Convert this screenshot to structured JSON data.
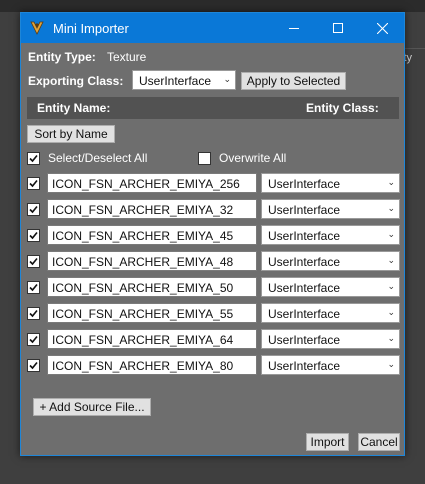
{
  "window": {
    "title": "Mini Importer",
    "colors": {
      "titlebar": "#0a78d7",
      "body": "#6e6e6e",
      "header": "#525252"
    }
  },
  "background": {
    "partial_text": "tity"
  },
  "entity_type": {
    "label": "Entity Type:",
    "value": "Texture"
  },
  "exporting_class": {
    "label": "Exporting Class:",
    "selected": "UserInterface",
    "apply_button": "Apply to Selected"
  },
  "headers": {
    "entity_name": "Entity Name:",
    "entity_class": "Entity Class:"
  },
  "sort_button": "Sort by Name",
  "select_all": {
    "label": "Select/Deselect All",
    "checked": true
  },
  "overwrite_all": {
    "label": "Overwrite All",
    "checked": false
  },
  "entities": [
    {
      "name": "ICON_FSN_ARCHER_EMIYA_256",
      "class": "UserInterface",
      "checked": true
    },
    {
      "name": "ICON_FSN_ARCHER_EMIYA_32",
      "class": "UserInterface",
      "checked": true
    },
    {
      "name": "ICON_FSN_ARCHER_EMIYA_45",
      "class": "UserInterface",
      "checked": true
    },
    {
      "name": "ICON_FSN_ARCHER_EMIYA_48",
      "class": "UserInterface",
      "checked": true
    },
    {
      "name": "ICON_FSN_ARCHER_EMIYA_50",
      "class": "UserInterface",
      "checked": true
    },
    {
      "name": "ICON_FSN_ARCHER_EMIYA_55",
      "class": "UserInterface",
      "checked": true
    },
    {
      "name": "ICON_FSN_ARCHER_EMIYA_64",
      "class": "UserInterface",
      "checked": true
    },
    {
      "name": "ICON_FSN_ARCHER_EMIYA_80",
      "class": "UserInterface",
      "checked": true
    }
  ],
  "add_source_button": "+ Add Source File...",
  "import_button": "Import",
  "cancel_button": "Cancel",
  "icons": {
    "app": "app-logo-icon",
    "minimize": "minimize-icon",
    "maximize": "maximize-icon",
    "close": "close-icon",
    "checkmark": "checkmark-icon",
    "dropdown": "chevron-down-icon"
  }
}
